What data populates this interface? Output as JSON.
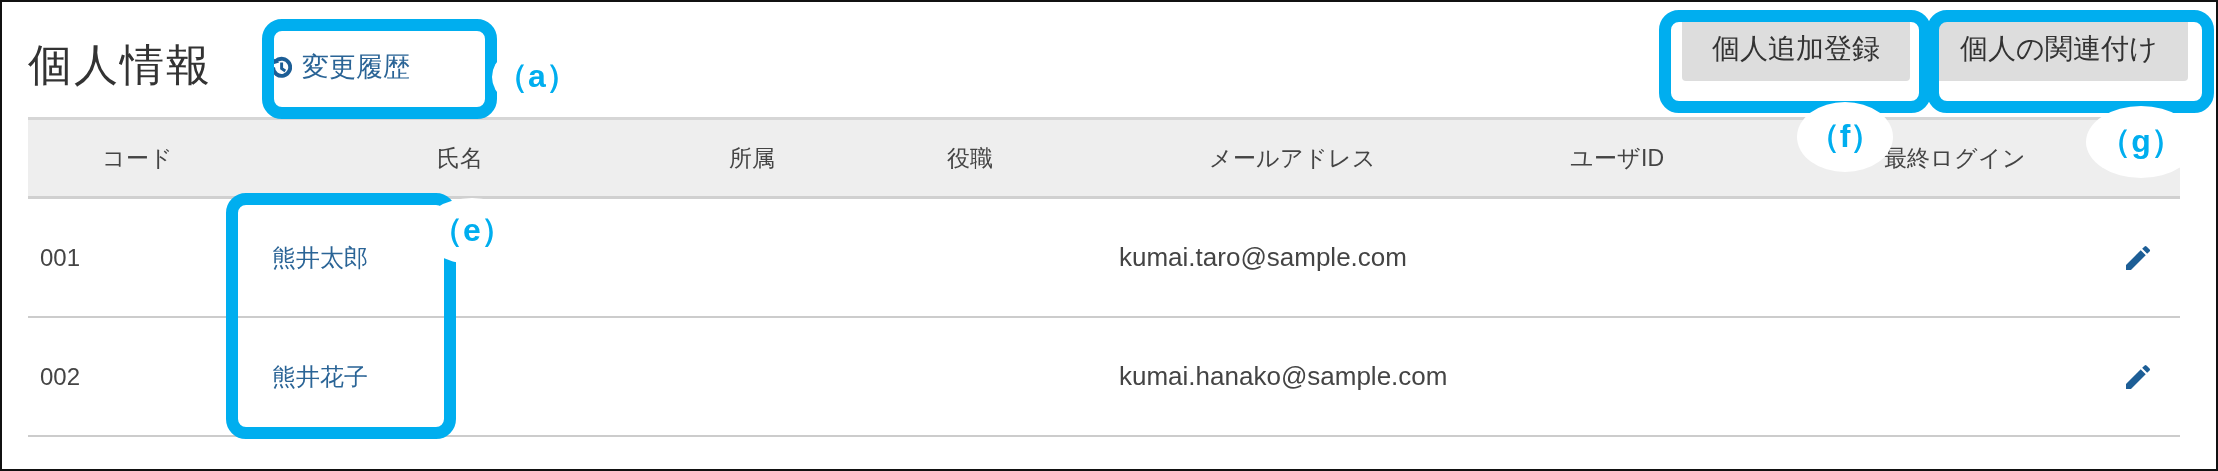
{
  "title": "個人情報",
  "history_link": {
    "label": "変更履歴"
  },
  "buttons": [
    {
      "label": "個人追加登録"
    },
    {
      "label": "個人の関連付け"
    }
  ],
  "table": {
    "columns": [
      "コード",
      "氏名",
      "所属",
      "役職",
      "メールアドレス",
      "ユーザID",
      "最終ログイン"
    ],
    "rows": [
      {
        "code": "001",
        "name": "熊井太郎",
        "email": "kumai.taro@sample.com"
      },
      {
        "code": "002",
        "name": "熊井花子",
        "email": "kumai.hanako@sample.com"
      }
    ]
  },
  "callouts": [
    {
      "label": "（a）"
    },
    {
      "label": "（e）"
    },
    {
      "label": "（f）"
    },
    {
      "label": "（g）"
    }
  ]
}
